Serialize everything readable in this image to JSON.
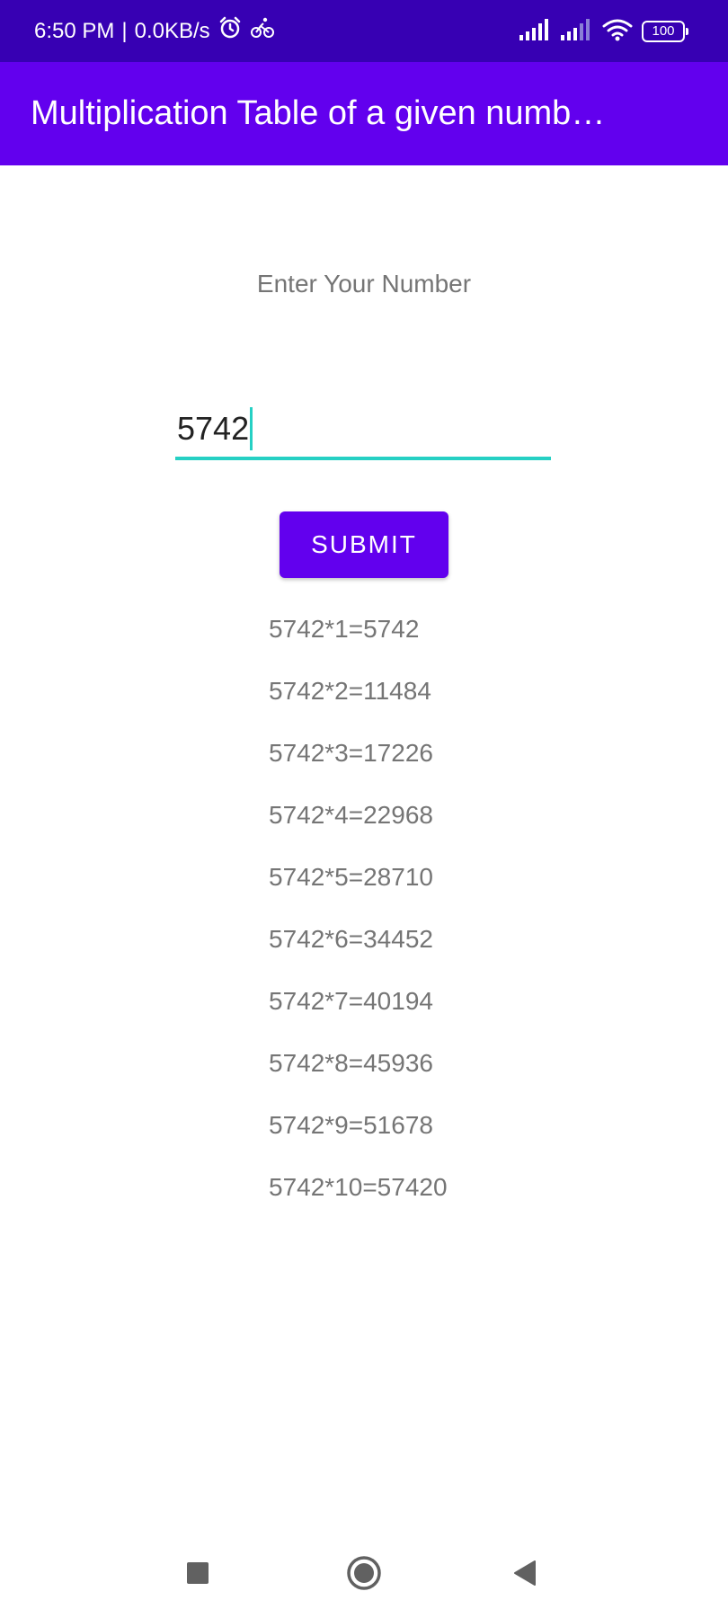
{
  "status_bar": {
    "time": "6:50 PM",
    "separator": "|",
    "net_speed": "0.0KB/s",
    "icons": [
      "alarm-icon",
      "cycling-icon",
      "signal-icon",
      "signal-icon",
      "wifi-icon",
      "battery-icon"
    ],
    "battery_level": "100"
  },
  "app_bar": {
    "title": "Multiplication Table of a given numb…"
  },
  "form": {
    "prompt": "Enter Your Number",
    "input_value": "5742",
    "submit_label": "SUBMIT"
  },
  "results": [
    "5742*1=5742",
    "5742*2=11484",
    "5742*3=17226",
    "5742*4=22968",
    "5742*5=28710",
    "5742*6=34452",
    "5742*7=40194",
    "5742*8=45936",
    "5742*9=51678",
    "5742*10=57420"
  ],
  "nav": {
    "icons": [
      "recents-icon",
      "home-icon",
      "back-icon"
    ]
  },
  "colors": {
    "status_bar": "#3700b3",
    "primary": "#6200ee",
    "accent": "#26d0c4",
    "text_secondary": "#757575"
  }
}
